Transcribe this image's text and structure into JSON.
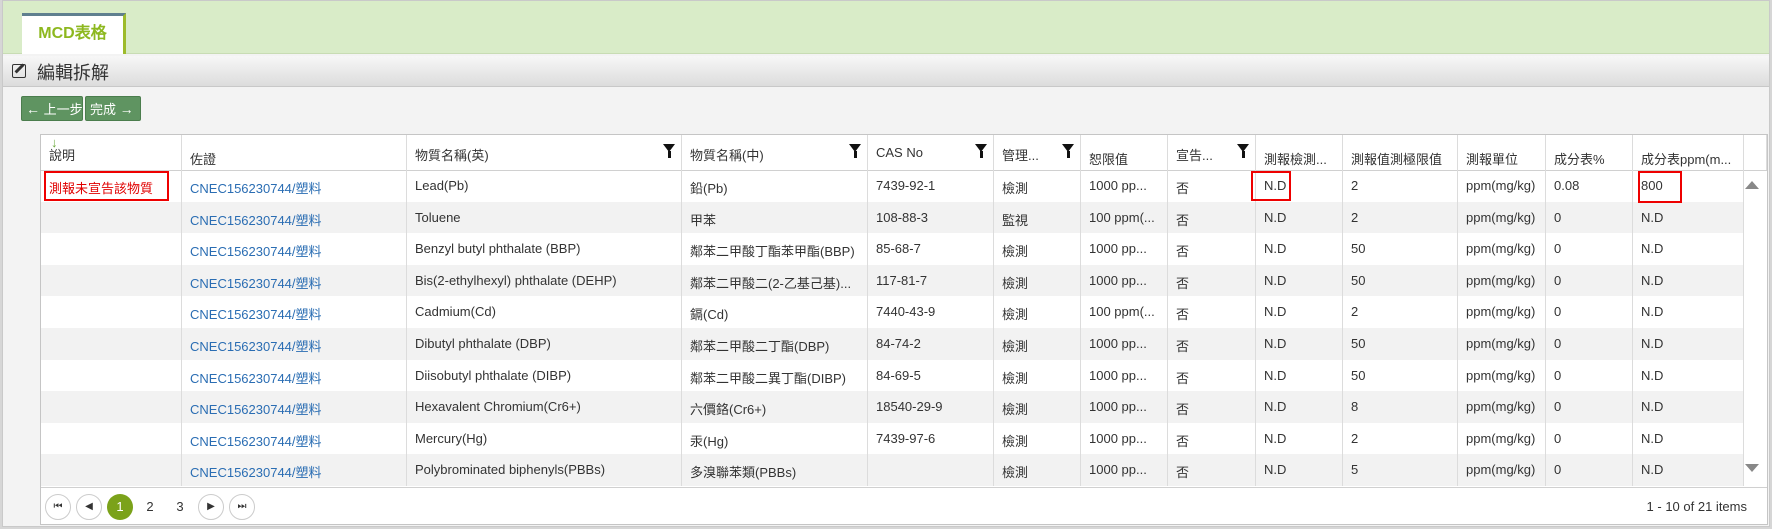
{
  "tab": {
    "label": "MCD表格"
  },
  "section": {
    "title": "編輯拆解"
  },
  "toolbar": {
    "prev_label": "上一步",
    "done_label": "完成"
  },
  "columns": [
    {
      "label": "說明",
      "sort": "desc",
      "filter": false
    },
    {
      "label": "佐證",
      "filter": false
    },
    {
      "label": "物質名稱(英)",
      "filter": true
    },
    {
      "label": "物質名稱(中)",
      "filter": true
    },
    {
      "label": "CAS No",
      "filter": true
    },
    {
      "label": "管理...",
      "filter": true
    },
    {
      "label": "恕限值",
      "filter": false
    },
    {
      "label": "宣告...",
      "filter": true
    },
    {
      "label": "測報檢測...",
      "filter": false
    },
    {
      "label": "測報值測極限值",
      "filter": false
    },
    {
      "label": "測報單位",
      "filter": false
    },
    {
      "label": "成分表%",
      "filter": false
    },
    {
      "label": "成分表ppm(m...",
      "filter": false
    }
  ],
  "rows": [
    {
      "note": "測報未宣告該物質",
      "evidence": "CNEC156230744/塑料",
      "name_en": "Lead(Pb)",
      "name_zh": "鉛(Pb)",
      "cas": "7439-92-1",
      "mgmt": "檢測",
      "limit": "1000 pp...",
      "declared": "否",
      "test": "N.D",
      "det_limit": "2",
      "unit": "ppm(mg/kg)",
      "pct": "0.08",
      "ppm": "800"
    },
    {
      "note": "",
      "evidence": "CNEC156230744/塑料",
      "name_en": "Toluene",
      "name_zh": "甲苯",
      "cas": "108-88-3",
      "mgmt": "監視",
      "limit": "100 ppm(...",
      "declared": "否",
      "test": "N.D",
      "det_limit": "2",
      "unit": "ppm(mg/kg)",
      "pct": "0",
      "ppm": "N.D"
    },
    {
      "note": "",
      "evidence": "CNEC156230744/塑料",
      "name_en": "Benzyl butyl phthalate (BBP)",
      "name_zh": "鄰苯二甲酸丁酯苯甲酯(BBP)",
      "cas": "85-68-7",
      "mgmt": "檢測",
      "limit": "1000 pp...",
      "declared": "否",
      "test": "N.D",
      "det_limit": "50",
      "unit": "ppm(mg/kg)",
      "pct": "0",
      "ppm": "N.D"
    },
    {
      "note": "",
      "evidence": "CNEC156230744/塑料",
      "name_en": "Bis(2-ethylhexyl) phthalate (DEHP)",
      "name_zh": "鄰苯二甲酸二(2-乙基己基)...",
      "cas": "117-81-7",
      "mgmt": "檢測",
      "limit": "1000 pp...",
      "declared": "否",
      "test": "N.D",
      "det_limit": "50",
      "unit": "ppm(mg/kg)",
      "pct": "0",
      "ppm": "N.D"
    },
    {
      "note": "",
      "evidence": "CNEC156230744/塑料",
      "name_en": "Cadmium(Cd)",
      "name_zh": "鎘(Cd)",
      "cas": "7440-43-9",
      "mgmt": "檢測",
      "limit": "100 ppm(...",
      "declared": "否",
      "test": "N.D",
      "det_limit": "2",
      "unit": "ppm(mg/kg)",
      "pct": "0",
      "ppm": "N.D"
    },
    {
      "note": "",
      "evidence": "CNEC156230744/塑料",
      "name_en": "Dibutyl phthalate (DBP)",
      "name_zh": "鄰苯二甲酸二丁酯(DBP)",
      "cas": "84-74-2",
      "mgmt": "檢測",
      "limit": "1000 pp...",
      "declared": "否",
      "test": "N.D",
      "det_limit": "50",
      "unit": "ppm(mg/kg)",
      "pct": "0",
      "ppm": "N.D"
    },
    {
      "note": "",
      "evidence": "CNEC156230744/塑料",
      "name_en": "Diisobutyl phthalate (DIBP)",
      "name_zh": "鄰苯二甲酸二異丁酯(DIBP)",
      "cas": "84-69-5",
      "mgmt": "檢測",
      "limit": "1000 pp...",
      "declared": "否",
      "test": "N.D",
      "det_limit": "50",
      "unit": "ppm(mg/kg)",
      "pct": "0",
      "ppm": "N.D"
    },
    {
      "note": "",
      "evidence": "CNEC156230744/塑料",
      "name_en": "Hexavalent Chromium(Cr6+)",
      "name_zh": "六價鉻(Cr6+)",
      "cas": "18540-29-9",
      "mgmt": "檢測",
      "limit": "1000 pp...",
      "declared": "否",
      "test": "N.D",
      "det_limit": "8",
      "unit": "ppm(mg/kg)",
      "pct": "0",
      "ppm": "N.D"
    },
    {
      "note": "",
      "evidence": "CNEC156230744/塑料",
      "name_en": "Mercury(Hg)",
      "name_zh": "汞(Hg)",
      "cas": "7439-97-6",
      "mgmt": "檢測",
      "limit": "1000 pp...",
      "declared": "否",
      "test": "N.D",
      "det_limit": "2",
      "unit": "ppm(mg/kg)",
      "pct": "0",
      "ppm": "N.D"
    },
    {
      "note": "",
      "evidence": "CNEC156230744/塑料",
      "name_en": "Polybrominated biphenyls(PBBs)",
      "name_zh": "多溴聯苯類(PBBs)",
      "cas": "",
      "mgmt": "檢測",
      "limit": "1000 pp...",
      "declared": "否",
      "test": "N.D",
      "det_limit": "5",
      "unit": "ppm(mg/kg)",
      "pct": "0",
      "ppm": "N.D"
    }
  ],
  "highlights": {
    "note_row": 0,
    "test_row": 0,
    "ppm_row": 0
  },
  "pager": {
    "pages": [
      "1",
      "2",
      "3"
    ],
    "current": "1",
    "info": "1 - 10 of 21 items"
  },
  "colors": {
    "accent": "#8db81f",
    "button": "#5f9461",
    "link": "#2a6db3",
    "alert": "#e00000"
  }
}
